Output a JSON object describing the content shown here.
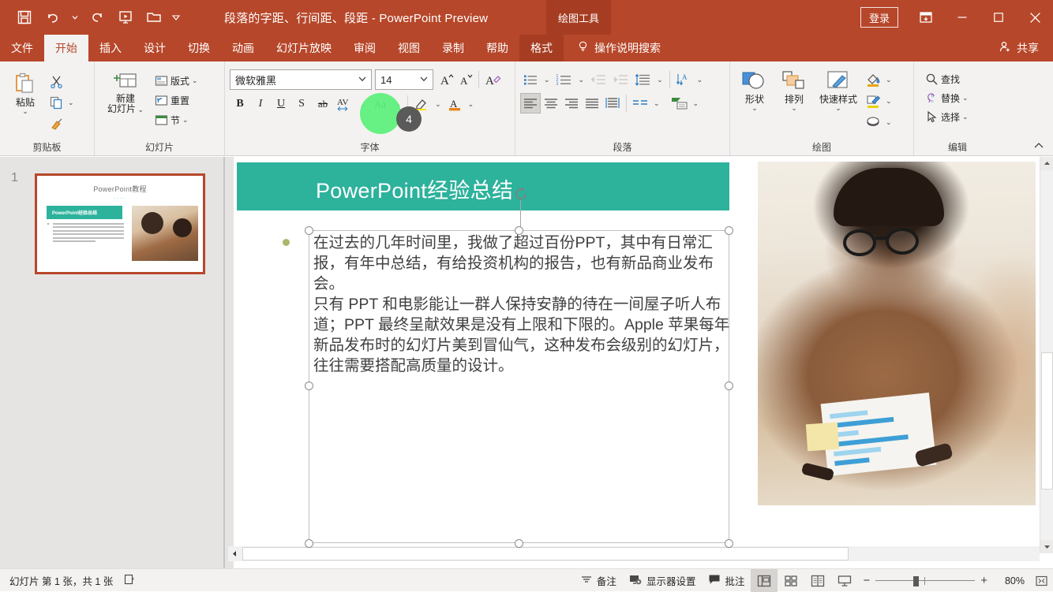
{
  "window": {
    "document_title": "段落的字距、行间距、段距  -  PowerPoint Preview",
    "context_tab_group": "绘图工具",
    "signin_label": "登录",
    "ribbon_display_icon": "ribbon-display-options-icon",
    "minimize_icon": "minimize-icon",
    "maximize_icon": "maximize-icon",
    "close_icon": "close-icon"
  },
  "quick_access": [
    {
      "name": "save-icon",
      "label": "保存"
    },
    {
      "name": "undo-icon",
      "label": "撤消"
    },
    {
      "name": "undo-dropdown-icon",
      "label": "撤消下拉"
    },
    {
      "name": "redo-icon",
      "label": "恢复"
    },
    {
      "name": "start-slideshow-icon",
      "label": "从头开始"
    },
    {
      "name": "open-icon",
      "label": "打开"
    },
    {
      "name": "customize-qat-icon",
      "label": "自定义快速访问工具栏"
    }
  ],
  "tabs": [
    {
      "label": "文件",
      "active": false,
      "ctx": false
    },
    {
      "label": "开始",
      "active": true,
      "ctx": false
    },
    {
      "label": "插入",
      "active": false,
      "ctx": false
    },
    {
      "label": "设计",
      "active": false,
      "ctx": false
    },
    {
      "label": "切换",
      "active": false,
      "ctx": false
    },
    {
      "label": "动画",
      "active": false,
      "ctx": false
    },
    {
      "label": "幻灯片放映",
      "active": false,
      "ctx": false
    },
    {
      "label": "审阅",
      "active": false,
      "ctx": false
    },
    {
      "label": "视图",
      "active": false,
      "ctx": false
    },
    {
      "label": "录制",
      "active": false,
      "ctx": false
    },
    {
      "label": "帮助",
      "active": false,
      "ctx": false
    },
    {
      "label": "格式",
      "active": false,
      "ctx": true
    }
  ],
  "tellme": {
    "label": "操作说明搜索",
    "icon": "lightbulb-icon"
  },
  "share": {
    "label": "共享",
    "icon": "share-person-icon"
  },
  "ribbon": {
    "groups": [
      {
        "label": "剪贴板",
        "has_launcher": true
      },
      {
        "label": "幻灯片",
        "has_launcher": false
      },
      {
        "label": "字体",
        "has_launcher": true
      },
      {
        "label": "段落",
        "has_launcher": true
      },
      {
        "label": "绘图",
        "has_launcher": true
      },
      {
        "label": "编辑",
        "has_launcher": false
      }
    ],
    "clipboard": {
      "paste_label": "粘贴",
      "cut_label": "剪切",
      "copy_label": "复制",
      "format_painter_label": "格式刷"
    },
    "slides": {
      "new_slide_line1": "新建",
      "new_slide_line2": "幻灯片",
      "layout_label": "版式",
      "reset_label": "重置",
      "section_label": "节"
    },
    "font": {
      "font_name": "微软雅黑",
      "font_size": "14",
      "grow_font_label": "A",
      "shrink_font_label": "A",
      "clear_format_label": "A",
      "bold_label": "B",
      "italic_label": "I",
      "underline_label": "U",
      "shadow_label": "S",
      "strikethrough_label": "ab",
      "char_spacing_label": "AV",
      "change_case_label": "Aa",
      "highlight_label": "A",
      "font_color_label": "A"
    },
    "paragraph": {
      "bullets": "项目符号",
      "numbering": "编号",
      "decrease_indent": "减少缩进量",
      "increase_indent": "增加缩进量",
      "line_spacing": "行距",
      "align_left": "左对齐",
      "align_center": "居中",
      "align_right": "右对齐",
      "justify": "两端对齐",
      "distribute": "分散对齐",
      "columns": "分栏",
      "text_direction": "文字方向",
      "align_text": "对齐文本",
      "convert_smartart": "转换为 SmartArt"
    },
    "drawing": {
      "shapes_label": "形状",
      "arrange_label": "排列",
      "quick_styles_label": "快速样式",
      "shape_fill": "形状填充",
      "shape_outline": "形状轮廓",
      "shape_effects": "形状效果"
    },
    "editing": {
      "find_label": "查找",
      "replace_label": "替换",
      "select_label": "选择"
    },
    "collapse_icon": "collapse-ribbon-icon"
  },
  "annotation": {
    "click_count": "4",
    "cursor_color": "#5BF07A",
    "badge_color": "#5A5A5A"
  },
  "thumbnails": [
    {
      "number": "1",
      "header": "PowerPoint教程",
      "teal_title": "PowerPoint经验总结",
      "selected": true
    }
  ],
  "slide": {
    "title": "PowerPoint经验总结",
    "title_bg_color": "#2DB29C",
    "paragraphs": [
      "在过去的几年时间里，我做了超过百份PPT，其中有日常汇报，有年中总结，有给投资机构的报告，也有新品商业发布会。",
      "只有 PPT 和电影能让一群人保持安静的待在一间屋子听人布道；PPT 最终呈献效果是没有上限和下限的。Apple 苹果每年新品发布时的幻灯片美到冒仙气，这种发布会级别的幻灯片，往往需要搭配高质量的设计。"
    ],
    "photo_alt": "办公室中戴眼镜的男士查看图表"
  },
  "statusbar": {
    "slide_count": "幻灯片 第 1 张，共 1 张",
    "language_icon": "spellcheck-icon",
    "notes_label": "备注",
    "display_settings_label": "显示器设置",
    "comments_label": "批注",
    "view_normal": "普通视图",
    "view_sorter": "幻灯片浏览",
    "view_reading": "阅读视图",
    "view_slideshow": "幻灯片放映",
    "zoom_out_label": "−",
    "zoom_in_label": "+",
    "zoom_percent": "80%",
    "fit_label": "使幻灯片适应当前窗口"
  }
}
